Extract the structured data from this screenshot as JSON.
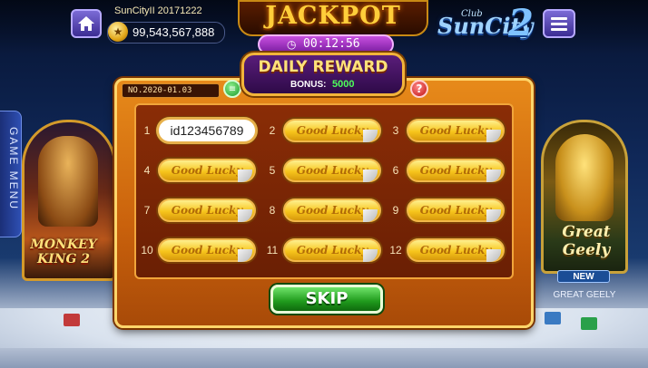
{
  "header": {
    "username": "SunCityII 20171222",
    "coins": "99,543,567,888",
    "jackpot_title": "JACKPOT",
    "timer": "00:12:56",
    "logo_club": "Club",
    "logo_name": "SunCity",
    "logo_number": "2"
  },
  "side_menu": {
    "label": "GAME MENU"
  },
  "left_card": {
    "title": "MONKEY KING 2"
  },
  "right_card": {
    "title": "Great Geely",
    "badge": "NEW",
    "subtitle": "GREAT GEELY"
  },
  "dialog": {
    "number_tag": "NO.2020-01.03",
    "title": "DAILY REWARD",
    "bonus_label": "BONUS:",
    "bonus_value": "5000",
    "skip_label": "SKIP",
    "slots": [
      {
        "number": "1",
        "label": "id123456789",
        "revealed": true
      },
      {
        "number": "2",
        "label": "Good Lucky",
        "revealed": false
      },
      {
        "number": "3",
        "label": "Good Lucky",
        "revealed": false
      },
      {
        "number": "4",
        "label": "Good Lucky",
        "revealed": false
      },
      {
        "number": "5",
        "label": "Good Lucky",
        "revealed": false
      },
      {
        "number": "6",
        "label": "Good Lucky",
        "revealed": false
      },
      {
        "number": "7",
        "label": "Good Lucky",
        "revealed": false
      },
      {
        "number": "8",
        "label": "Good Lucky",
        "revealed": false
      },
      {
        "number": "9",
        "label": "Good Lucky",
        "revealed": false
      },
      {
        "number": "10",
        "label": "Good Lucky",
        "revealed": false
      },
      {
        "number": "11",
        "label": "Good Lucky",
        "revealed": false
      },
      {
        "number": "12",
        "label": "Good Lucky",
        "revealed": false
      }
    ]
  },
  "icons": {
    "home": "home-icon",
    "menu": "hamburger-menu-icon",
    "coin": "coin-icon",
    "clock": "clock-icon",
    "list": "list-icon",
    "help": "question-mark-icon"
  },
  "colors": {
    "dialog_orange": "#e78a1a",
    "slot_gold": "#f7c51c",
    "skip_green": "#1f9a1c",
    "bonus_green": "#4dff5a",
    "banner_purple": "#5a1d7a"
  }
}
